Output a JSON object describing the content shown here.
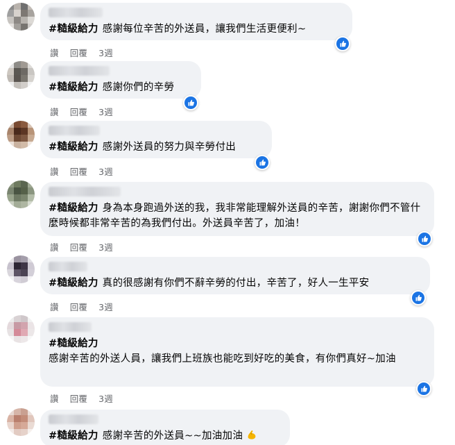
{
  "comments": [
    {
      "hashtag": "#糙級給力",
      "text": "感謝每位辛苦的外送員，讓我們生活更便利~",
      "actions": {
        "like": "讚",
        "reply": "回覆",
        "time": "3週"
      },
      "avatar_colors": [
        "#8a8a8a",
        "#b9b3ad",
        "#6f6f6f",
        "#c2bcb6",
        "#9f9f9f",
        "#d7d2cd",
        "#7d7873",
        "#a7a39e",
        "#c7c4c0",
        "#8d8985",
        "#b7b3ae",
        "#dcd9d5",
        "#e5e2df",
        "#a3a09c",
        "#777470",
        "#cfccc9"
      ]
    },
    {
      "hashtag": "#糙級給力",
      "text": "感謝你們的辛勞",
      "actions": {
        "like": "讚",
        "reply": "回覆",
        "time": "3週"
      },
      "avatar_colors": [
        "#e3e3e3",
        "#8e8c88",
        "#a09a93",
        "#dedcd9",
        "#cdc7c0",
        "#5b5853",
        "#6d6964",
        "#c9c6c2",
        "#bfbab4",
        "#5a5550",
        "#7a766f",
        "#d6d3cf",
        "#eeeeee",
        "#c4c0bb",
        "#d2ceca",
        "#f3f3f3"
      ]
    },
    {
      "hashtag": "#糙級給力",
      "text": "感謝外送員的努力與辛勞付出",
      "actions": {
        "like": "讚",
        "reply": "回覆",
        "time": "3週"
      },
      "avatar_colors": [
        "#cdb9aa",
        "#7a4b32",
        "#8a5a3e",
        "#d8c3b4",
        "#a8846b",
        "#4a2a1c",
        "#5c3624",
        "#b89478",
        "#bb9c85",
        "#6e4a35",
        "#7e5842",
        "#c7aa92",
        "#eadfd6",
        "#c9b2a0",
        "#d2bba8",
        "#f1e8e1"
      ]
    },
    {
      "hashtag": "#糙級給力",
      "text": "身為本身跑過外送的我，我非常能理解外送員的辛苦，謝謝你們不管什麼時候都非常辛苦的為我們付出。外送員辛苦了，加油！",
      "actions": {
        "like": "讚",
        "reply": "回覆",
        "time": "3週"
      },
      "avatar_colors": [
        "#8f9a82",
        "#6e7a5f",
        "#5b6650",
        "#a1aa95",
        "#7a8570",
        "#4a5543",
        "#566149",
        "#8b9680",
        "#9aa58d",
        "#6f7a64",
        "#7b866e",
        "#b3bca8",
        "#c9cfc1",
        "#a3ac97",
        "#aeb6a2",
        "#d6dbcf"
      ]
    },
    {
      "hashtag": "#糙級給力",
      "text": "真的很感謝有你們不辭辛勞的付出，辛苦了，好人一生平安",
      "actions": {
        "like": "讚",
        "reply": "回覆",
        "time": "3週"
      },
      "avatar_colors": [
        "#e8e6ea",
        "#9a93a0",
        "#a49eab",
        "#e2e0e5",
        "#c7c2cd",
        "#2c2533",
        "#3e3546",
        "#cfcad4",
        "#d9d6dc",
        "#5d5465",
        "#4b4353",
        "#d3cfd8",
        "#f3f2f4",
        "#d8d4dc",
        "#d0ccd4",
        "#f6f5f7"
      ]
    },
    {
      "hashtag": "#糙級給力",
      "text": "感謝辛苦的外送人員，讓我們上班族也能吃到好吃的美食，有你們真好~加油",
      "actions": {
        "like": "讚",
        "reply": "回覆",
        "time": "3週"
      },
      "avatar_colors": [
        "#ededed",
        "#d9d2d4",
        "#cfc7ca",
        "#f2f2f2",
        "#e4d9dc",
        "#c79aa4",
        "#d2a4ae",
        "#ebe4e6",
        "#e7e2e3",
        "#d48a98",
        "#e0a9b3",
        "#ece7e8",
        "#f6f6f6",
        "#e9e3e4",
        "#ede8e9",
        "#f8f8f8"
      ]
    },
    {
      "hashtag": "#糙級給力",
      "text": "感謝辛苦的外送員~~加油加油",
      "actions": {
        "like": "讚",
        "reply": "回覆",
        "time": "3週"
      },
      "avatar_colors": [
        "#e7d8d2",
        "#d6b5a8",
        "#c9a091",
        "#ecdfda",
        "#d9b3a4",
        "#b97f6d",
        "#c38c79",
        "#e1c7bd",
        "#e9d5cd",
        "#cf9f8d",
        "#d6a998",
        "#eadbd4",
        "#f3ebe8",
        "#e2cbc2",
        "#e6d2ca",
        "#f6f0ed"
      ]
    }
  ],
  "colors": {
    "bubble": "#f0f2f5",
    "like_blue": "#1b74e4",
    "secondary_text": "#65676b",
    "flex_emoji": "#f5b400"
  },
  "icons": {
    "like": "thumbs-up-icon",
    "emoji": "flexed-biceps-emoji"
  }
}
